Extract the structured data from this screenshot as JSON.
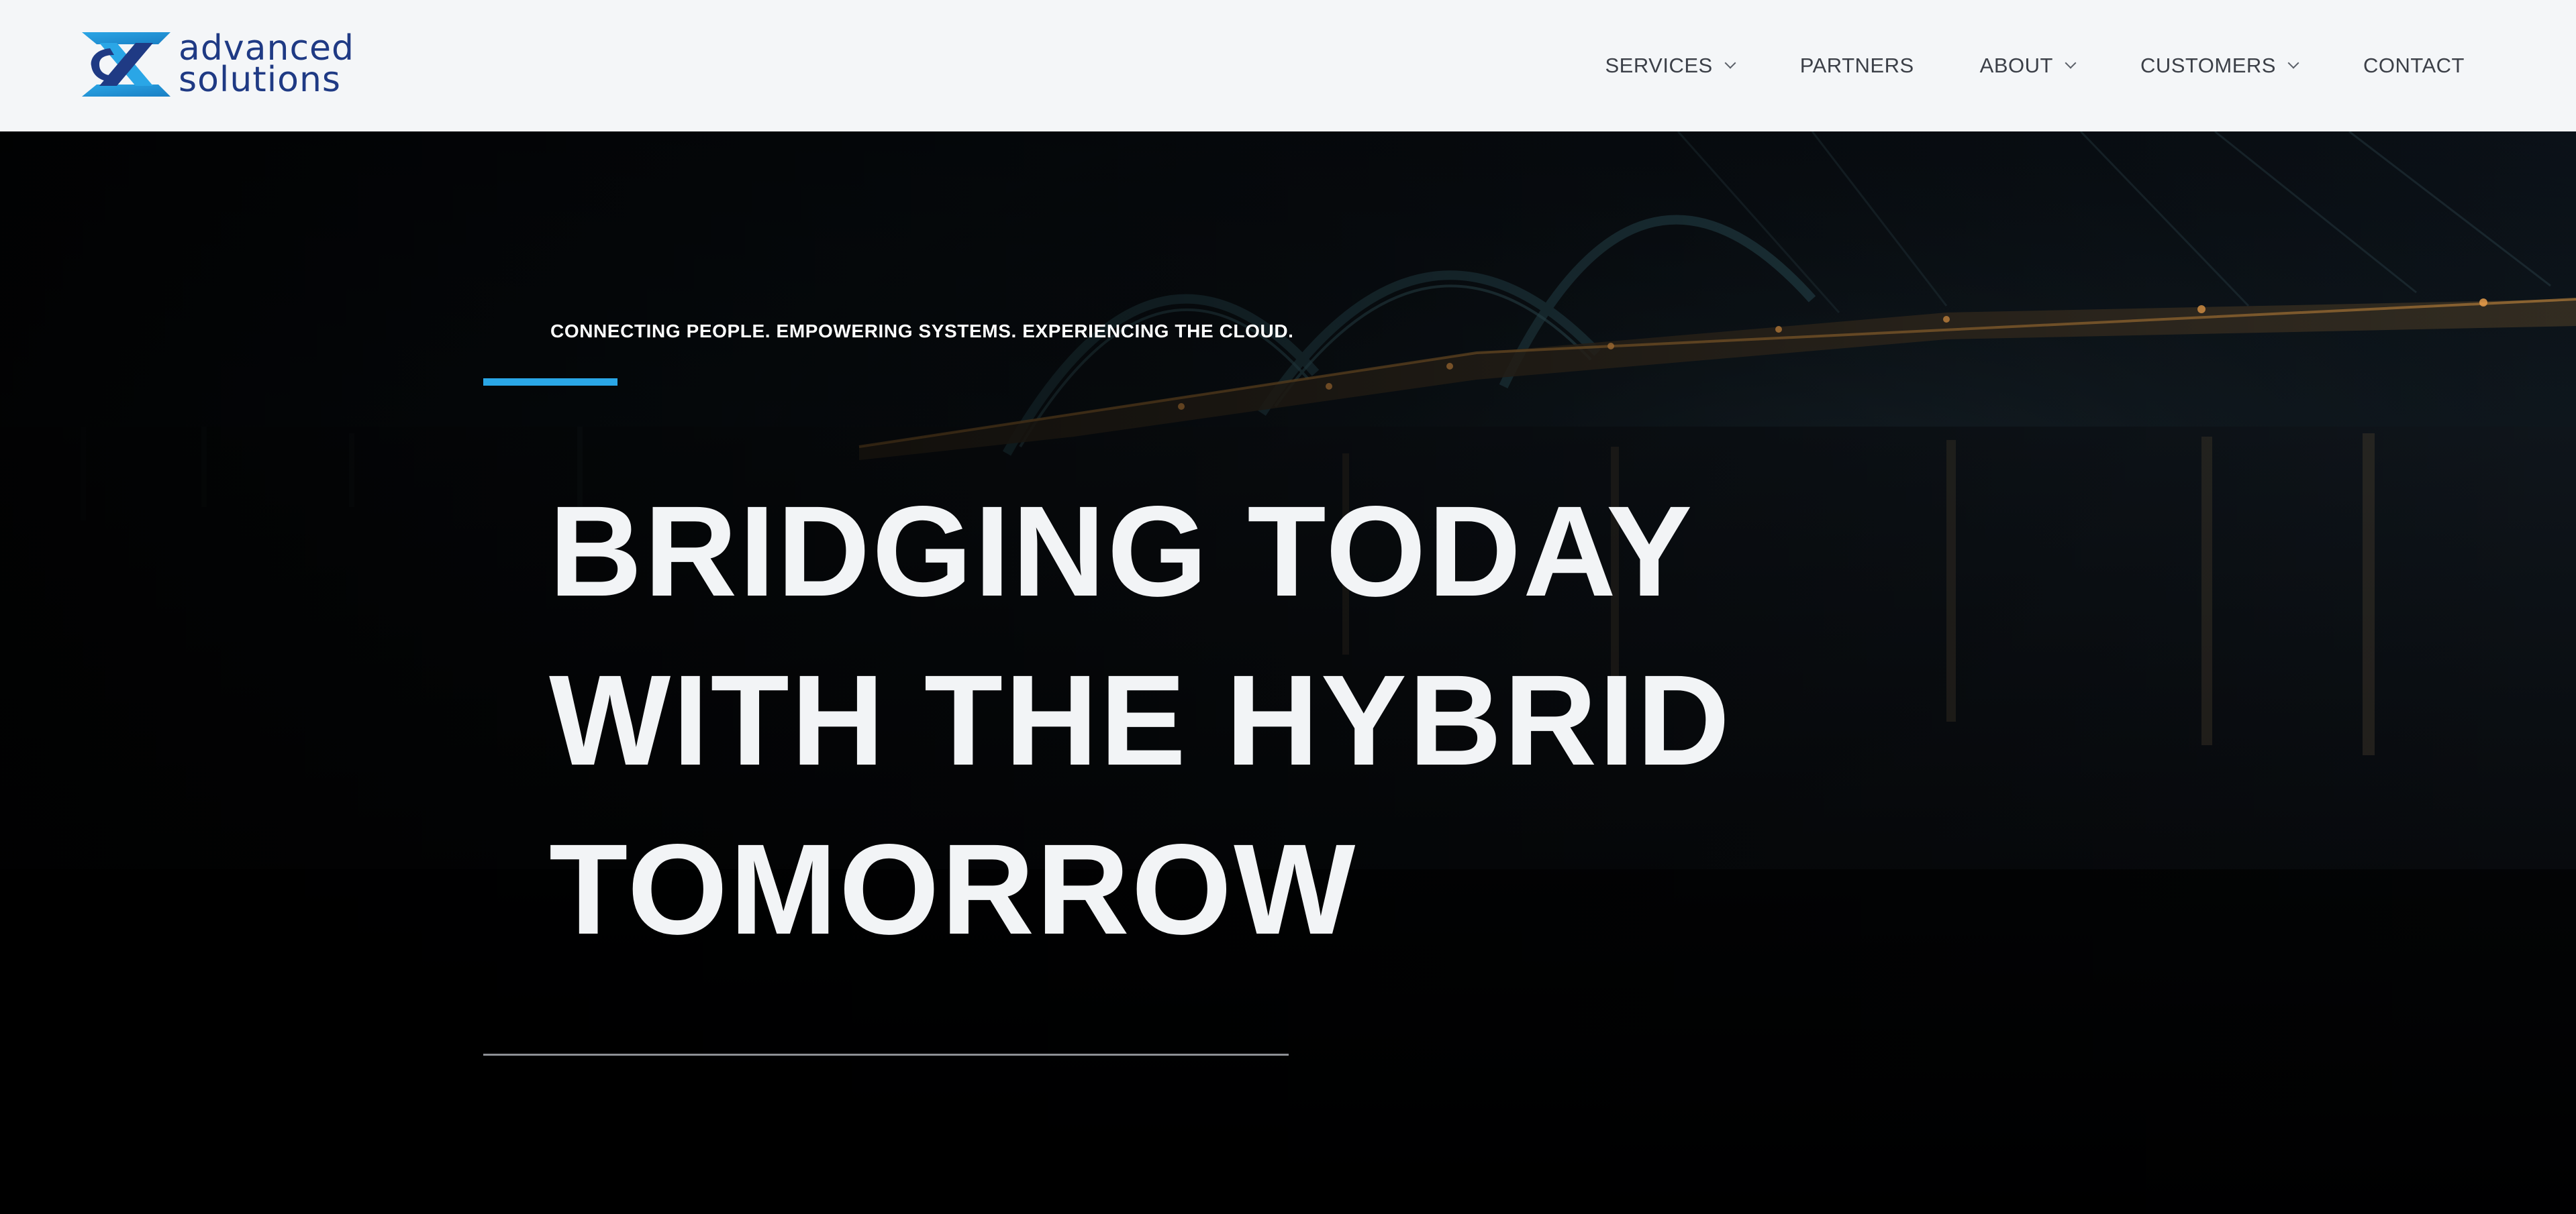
{
  "brand": {
    "logo_icon": "ax-logo-icon",
    "line1": "advanced",
    "line2": "solutions",
    "colors": {
      "primary": "#1f3a84",
      "accent": "#2aa6e6"
    }
  },
  "nav": {
    "items": [
      {
        "label": "SERVICES",
        "has_dropdown": true,
        "icon": "chevron-down-icon"
      },
      {
        "label": "PARTNERS",
        "has_dropdown": false
      },
      {
        "label": "ABOUT",
        "has_dropdown": true,
        "icon": "chevron-down-icon"
      },
      {
        "label": "CUSTOMERS",
        "has_dropdown": true,
        "icon": "chevron-down-icon"
      },
      {
        "label": "CONTACT",
        "has_dropdown": false
      }
    ]
  },
  "hero": {
    "background": "night bridge over river",
    "tagline": "CONNECTING PEOPLE. EMPOWERING SYSTEMS. EXPERIENCING THE CLOUD.",
    "headline": {
      "line1": "BRIDGING TODAY",
      "line2": "WITH THE HYBRID",
      "line3": "TOMORROW"
    },
    "accent_color": "#2aa6e6"
  }
}
